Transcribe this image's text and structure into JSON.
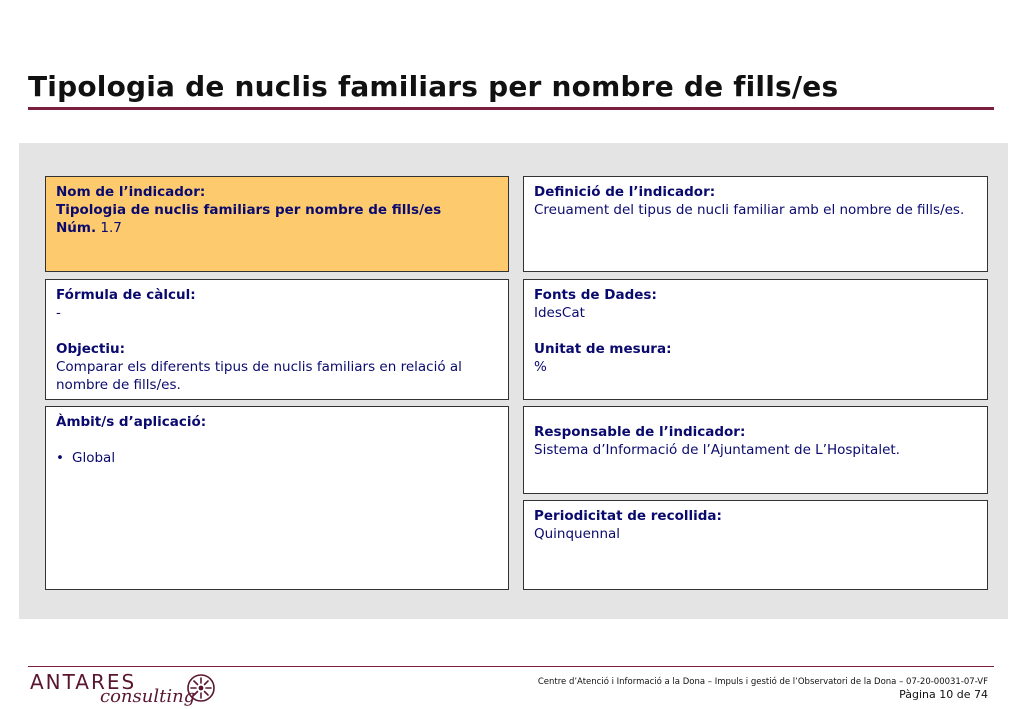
{
  "title": "Tipologia de nuclis familiars per nombre de fills/es",
  "nom": {
    "label": "Nom de l’indicador:",
    "value": "Tipologia de nuclis familiars per nombre de fills/es",
    "num_label": "Núm.",
    "num_value": "1.7"
  },
  "definicio": {
    "label": "Definició de l’indicador:",
    "value": "Creuament del tipus de nucli familiar amb el nombre de fills/es."
  },
  "formula": {
    "label": "Fórmula de càlcul:",
    "value": "-",
    "objectiu_label": "Objectiu:",
    "objectiu_value": "Comparar els diferents tipus de nuclis familiars en relació al nombre de fills/es."
  },
  "fonts": {
    "label": "Fonts de Dades:",
    "value": "IdesCat",
    "unitat_label": "Unitat de mesura:",
    "unitat_value": "%"
  },
  "ambit": {
    "label": "Àmbit/s d’aplicació:",
    "bullet": "•",
    "items": [
      "Global"
    ]
  },
  "responsable": {
    "label": "Responsable de l’indicador:",
    "value": "Sistema d’Informació de l’Ajuntament de L’Hospitalet."
  },
  "periodicitat": {
    "label": "Periodicitat de recollida:",
    "value": "Quinquennal"
  },
  "footer": {
    "brand": "ANTARES",
    "brand_sub": "consulting",
    "text": "Centre d’Atenció i Informació a la Dona – Impuls i gestió de l’Observatori de la Dona – 07-20-00031-07-VF",
    "page": "Pàgina 10 de 74"
  },
  "colors": {
    "title_rule": "#7a1f3d",
    "panel_bg": "#e4e4e4",
    "highlight_box": "#fdcb6e",
    "text_blue": "#0a0a6e"
  }
}
